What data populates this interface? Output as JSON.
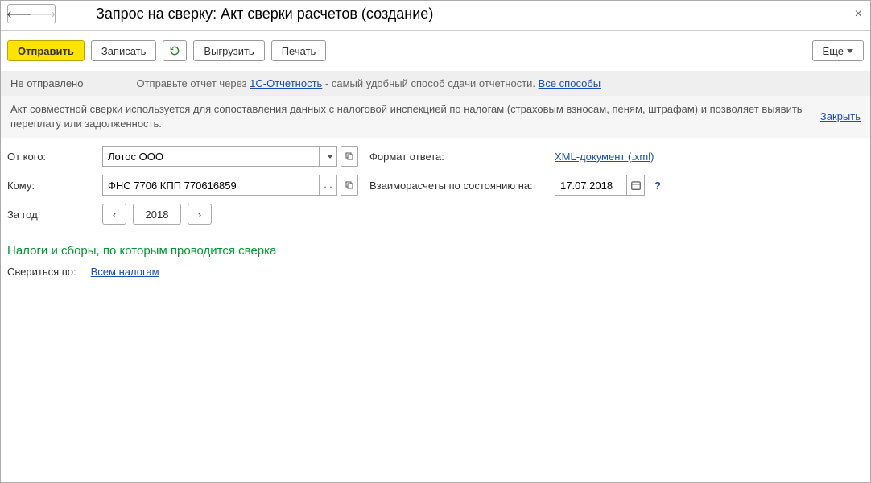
{
  "header": {
    "title": "Запрос на сверку: Акт сверки расчетов (создание)"
  },
  "toolbar": {
    "send": "Отправить",
    "save": "Записать",
    "export": "Выгрузить",
    "print": "Печать",
    "more": "Еще"
  },
  "status": {
    "state": "Не отправлено",
    "hint_prefix": "Отправьте отчет через ",
    "link": "1С-Отчетность",
    "hint_suffix": " - самый удобный способ сдачи отчетности. ",
    "all_methods": "Все способы"
  },
  "info": {
    "text": "Акт совместной сверки используется для сопоставления данных с налоговой инспекцией по налогам (страховым взносам, пеням, штрафам) и позволяет выявить переплату или задолженность.",
    "close": "Закрыть"
  },
  "form": {
    "from_label": "От кого:",
    "from_value": "Лотос ООО",
    "to_label": "Кому:",
    "to_value": "ФНС 7706 КПП 770616859",
    "year_label": "За год:",
    "year_value": "2018",
    "format_label": "Формат ответа:",
    "format_link": "XML-документ (.xml)",
    "asof_label": "Взаиморасчеты по состоянию на:",
    "asof_value": "17.07.2018"
  },
  "section": {
    "title": "Налоги и сборы, по которым проводится сверка",
    "reconcile_label": "Свериться по:",
    "reconcile_link": "Всем налогам"
  }
}
